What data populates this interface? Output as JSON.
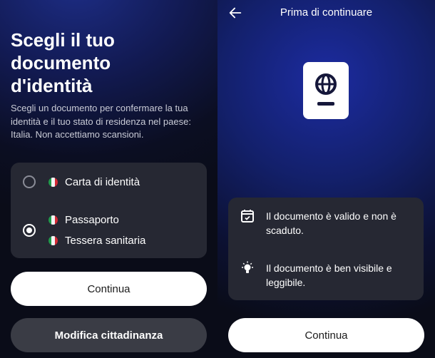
{
  "left": {
    "title": "Scegli il tuo\ndocumento\nd'identità",
    "description": "Scegli un documento per confermare la tua\nidentità e il tuo stato di residenza nel paese:\nItalia. Non accettiamo scansioni.",
    "options": [
      {
        "label": "Carta di identità",
        "selected": false
      },
      {
        "label": "Passaporto",
        "selected": true
      },
      {
        "label": "Tessera sanitaria",
        "selected": true
      }
    ],
    "continue_label": "Continua",
    "modify_label": "Modifica cittadinanza"
  },
  "right": {
    "header_title": "Prima di continuare",
    "items": [
      {
        "icon": "calendar-check-icon",
        "text": "Il documento è valido e non è scaduto."
      },
      {
        "icon": "lightbulb-icon",
        "text": "Il documento è ben visibile e leggibile."
      }
    ],
    "continue_label": "Continua"
  },
  "colors": {
    "flag_green": "#1f9a4a",
    "flag_white": "#f3f3f3",
    "flag_red": "#d22a35",
    "card_bg": "#262833",
    "button_primary": "#ffffff",
    "button_secondary": "#3a3c45"
  }
}
